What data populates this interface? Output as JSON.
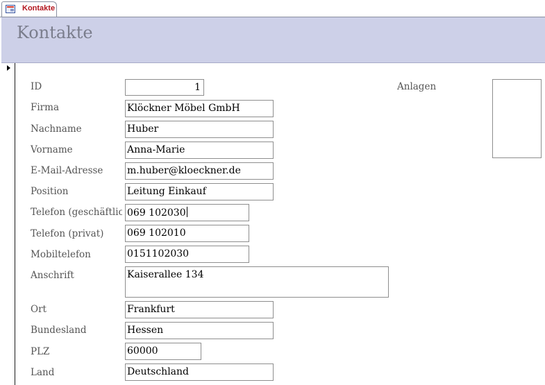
{
  "tab": {
    "label": "Kontakte",
    "icon": "form-icon"
  },
  "header": {
    "title": "Kontakte"
  },
  "fields": [
    {
      "label": "ID",
      "value": "1"
    },
    {
      "label": "Firma",
      "value": "Klöckner Möbel GmbH"
    },
    {
      "label": "Nachname",
      "value": "Huber"
    },
    {
      "label": "Vorname",
      "value": "Anna-Marie"
    },
    {
      "label": "E-Mail-Adresse",
      "value": "m.huber@kloeckner.de"
    },
    {
      "label": "Position",
      "value": "Leitung Einkauf"
    },
    {
      "label": "Telefon (geschäftlich)",
      "value": "069 102030"
    },
    {
      "label": "Telefon (privat)",
      "value": "069 102010"
    },
    {
      "label": "Mobiltelefon",
      "value": "0151102030"
    },
    {
      "label": "Anschrift",
      "value": "Kaiserallee 134"
    },
    {
      "label": "Ort",
      "value": "Frankfurt"
    },
    {
      "label": "Bundesland",
      "value": "Hessen"
    },
    {
      "label": "PLZ",
      "value": "60000"
    },
    {
      "label": "Land",
      "value": "Deutschland"
    }
  ],
  "attachments": {
    "label": "Anlagen"
  }
}
